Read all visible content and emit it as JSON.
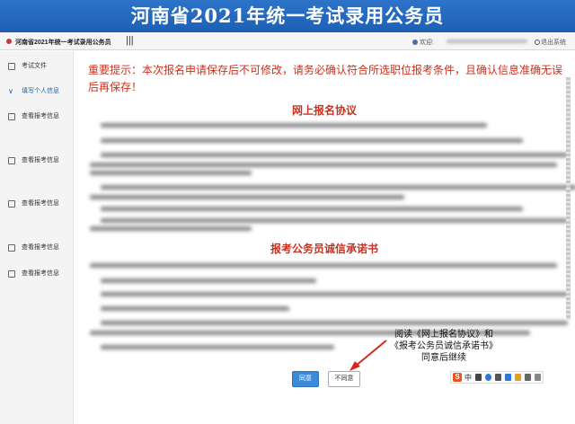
{
  "banner": {
    "title": "河南省2021年统一考试录用公务员"
  },
  "topbar": {
    "app_title": "河南省2021年统一考试录用公务员",
    "menu_toggle": "|||",
    "user_label": "欢迎:",
    "logout": "退出系统"
  },
  "sidebar": {
    "items": [
      {
        "label": "考试文件",
        "icon": "document-icon"
      },
      {
        "label": "填写个人信息",
        "icon": "check-icon"
      },
      {
        "label": "查看报考信息",
        "icon": "document-icon"
      },
      {
        "label": "查看报考信息",
        "icon": "document-icon"
      },
      {
        "label": "查看报考信息",
        "icon": "document-icon"
      },
      {
        "label": "查看报考信息",
        "icon": "document-icon"
      },
      {
        "label": "查看报考信息",
        "icon": "document-icon"
      }
    ]
  },
  "main": {
    "warning": "重要提示：本次报名申请保存后不可修改，请务必确认符合所选职位报考条件，且确认信息准确无误后再保存！",
    "agreement_title": "网上报名协议",
    "pledge_title": "报考公务员诚信承诺书",
    "annotation": [
      "阅读《网上报名协议》和",
      "《报考公务员诚信承诺书》",
      "同意后继续"
    ],
    "agree_button": "同意",
    "disagree_button": "不同意"
  },
  "ime": {
    "logo": "S",
    "mode": "中"
  },
  "colors": {
    "banner": "#1e5fb4",
    "warning": "#c8321f",
    "agree": "#3d8ad6",
    "arrow": "#d42a1e"
  }
}
